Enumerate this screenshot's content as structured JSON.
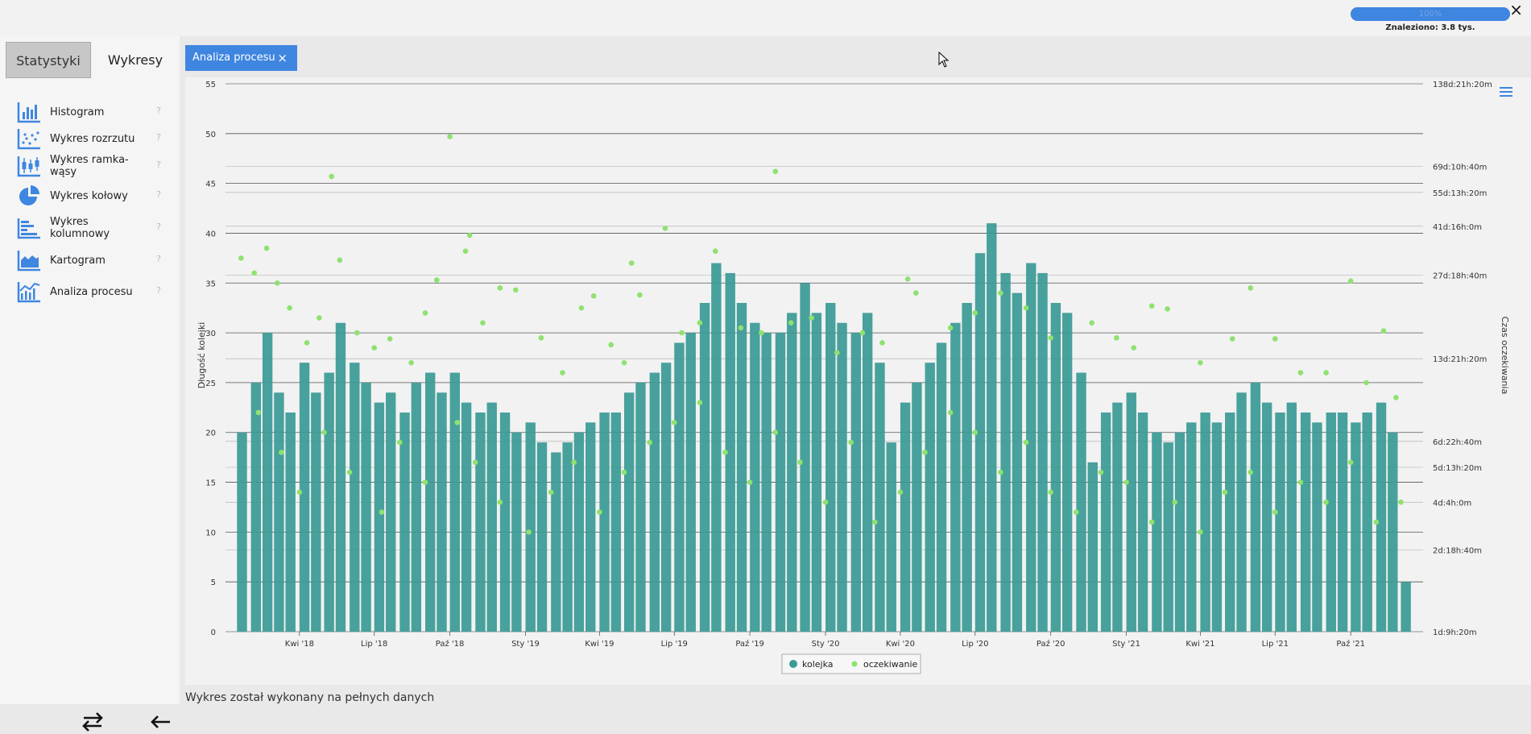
{
  "header": {
    "close_label": "×",
    "progress_text": "100%",
    "progress_value": 1.0,
    "found_text": "Znaleziono: 3.8 tys."
  },
  "sidebar": {
    "tabs": [
      {
        "label": "Statystyki",
        "active": false
      },
      {
        "label": "Wykresy",
        "active": true
      }
    ],
    "items": [
      {
        "label": "Histogram",
        "icon": "histogram-icon",
        "help": "?"
      },
      {
        "label": "Wykres rozrzutu",
        "icon": "scatter-icon",
        "help": "?"
      },
      {
        "label": "Wykres ramka-wąsy",
        "icon": "boxplot-icon",
        "help": "?"
      },
      {
        "label": "Wykres kołowy",
        "icon": "pie-icon",
        "help": "?"
      },
      {
        "label": "Wykres kolumnowy",
        "icon": "bar-horizontal-icon",
        "help": "?"
      },
      {
        "label": "Kartogram",
        "icon": "area-map-icon",
        "help": "?"
      },
      {
        "label": "Analiza procesu",
        "icon": "process-icon",
        "help": "?"
      }
    ],
    "bottom": {
      "swap_icon": "swap-arrows-icon",
      "back_icon": "arrow-left-icon"
    }
  },
  "main": {
    "tab": {
      "label": "Analiza procesu",
      "close": "×"
    },
    "footer_note": "Wykres został wykonany na pełnych danych",
    "menu_icon": "hamburger-menu-icon"
  },
  "colors": {
    "accent": "#3f86e0",
    "bar_color": "#3a9a95",
    "point_color": "#8ee26f"
  },
  "chart_data": {
    "type": "bar",
    "ylabel": "Długość kolejki",
    "y2label": "Czas oczekiwania",
    "ylim": [
      0,
      55
    ],
    "yticks": [
      0,
      5,
      10,
      15,
      20,
      25,
      30,
      35,
      40,
      45,
      50,
      55
    ],
    "y2ticks": [
      {
        "label": "1d:9h:20m",
        "value": 0
      },
      {
        "label": "2d:18h:40m",
        "value": 8.2
      },
      {
        "label": "4d:4h:0m",
        "value": 13.0
      },
      {
        "label": "5d:13h:20m",
        "value": 16.5
      },
      {
        "label": "6d:22h:40m",
        "value": 19.1
      },
      {
        "label": "13d:21h:20m",
        "value": 27.4
      },
      {
        "label": "27d:18h:40m",
        "value": 35.8
      },
      {
        "label": "41d:16h:0m",
        "value": 40.7
      },
      {
        "label": "55d:13h:20m",
        "value": 44.1
      },
      {
        "label": "69d:10h:40m",
        "value": 46.7
      },
      {
        "label": "138d:21h:20m",
        "value": 55
      }
    ],
    "x_range": [
      "2018-01",
      "2021-12"
    ],
    "xticks": [
      {
        "label": "Kwi '18",
        "date": "2018-04-01"
      },
      {
        "label": "Lip '18",
        "date": "2018-07-01"
      },
      {
        "label": "Paź '18",
        "date": "2018-10-01"
      },
      {
        "label": "Sty '19",
        "date": "2019-01-01"
      },
      {
        "label": "Kwi '19",
        "date": "2019-04-01"
      },
      {
        "label": "Lip '19",
        "date": "2019-07-01"
      },
      {
        "label": "Paź '19",
        "date": "2019-10-01"
      },
      {
        "label": "Sty '20",
        "date": "2020-01-01"
      },
      {
        "label": "Kwi '20",
        "date": "2020-04-01"
      },
      {
        "label": "Lip '20",
        "date": "2020-07-01"
      },
      {
        "label": "Paź '20",
        "date": "2020-10-01"
      },
      {
        "label": "Sty '21",
        "date": "2021-01-01"
      },
      {
        "label": "Kwi '21",
        "date": "2021-04-01"
      },
      {
        "label": "Lip '21",
        "date": "2021-07-01"
      },
      {
        "label": "Paź '21",
        "date": "2021-10-01"
      }
    ],
    "series": [
      {
        "name": "kolejka",
        "kind": "bar",
        "points": [
          [
            "2018-01-15",
            20
          ],
          [
            "2018-02-01",
            25
          ],
          [
            "2018-02-15",
            30
          ],
          [
            "2018-03-01",
            24
          ],
          [
            "2018-03-15",
            22
          ],
          [
            "2018-04-01",
            27
          ],
          [
            "2018-04-15",
            24
          ],
          [
            "2018-05-01",
            26
          ],
          [
            "2018-05-15",
            31
          ],
          [
            "2018-06-01",
            27
          ],
          [
            "2018-06-15",
            25
          ],
          [
            "2018-07-01",
            23
          ],
          [
            "2018-07-15",
            24
          ],
          [
            "2018-08-01",
            22
          ],
          [
            "2018-08-15",
            25
          ],
          [
            "2018-09-01",
            26
          ],
          [
            "2018-09-15",
            24
          ],
          [
            "2018-10-01",
            26
          ],
          [
            "2018-10-15",
            23
          ],
          [
            "2018-11-01",
            22
          ],
          [
            "2018-11-15",
            23
          ],
          [
            "2018-12-01",
            22
          ],
          [
            "2018-12-15",
            20
          ],
          [
            "2019-01-01",
            21
          ],
          [
            "2019-01-15",
            19
          ],
          [
            "2019-02-01",
            18
          ],
          [
            "2019-02-15",
            19
          ],
          [
            "2019-03-01",
            20
          ],
          [
            "2019-03-15",
            21
          ],
          [
            "2019-04-01",
            22
          ],
          [
            "2019-04-15",
            22
          ],
          [
            "2019-05-01",
            24
          ],
          [
            "2019-05-15",
            25
          ],
          [
            "2019-06-01",
            26
          ],
          [
            "2019-06-15",
            27
          ],
          [
            "2019-07-01",
            29
          ],
          [
            "2019-07-15",
            30
          ],
          [
            "2019-08-01",
            33
          ],
          [
            "2019-08-15",
            37
          ],
          [
            "2019-09-01",
            36
          ],
          [
            "2019-09-15",
            33
          ],
          [
            "2019-10-01",
            31
          ],
          [
            "2019-10-15",
            30
          ],
          [
            "2019-11-01",
            30
          ],
          [
            "2019-11-15",
            32
          ],
          [
            "2019-12-01",
            35
          ],
          [
            "2019-12-15",
            32
          ],
          [
            "2020-01-01",
            33
          ],
          [
            "2020-01-15",
            31
          ],
          [
            "2020-02-01",
            30
          ],
          [
            "2020-02-15",
            32
          ],
          [
            "2020-03-01",
            27
          ],
          [
            "2020-03-15",
            19
          ],
          [
            "2020-04-01",
            23
          ],
          [
            "2020-04-15",
            25
          ],
          [
            "2020-05-01",
            27
          ],
          [
            "2020-05-15",
            29
          ],
          [
            "2020-06-01",
            31
          ],
          [
            "2020-06-15",
            33
          ],
          [
            "2020-07-01",
            38
          ],
          [
            "2020-07-15",
            41
          ],
          [
            "2020-08-01",
            36
          ],
          [
            "2020-08-15",
            34
          ],
          [
            "2020-09-01",
            37
          ],
          [
            "2020-09-15",
            36
          ],
          [
            "2020-10-01",
            33
          ],
          [
            "2020-10-15",
            32
          ],
          [
            "2020-11-01",
            26
          ],
          [
            "2020-11-15",
            17
          ],
          [
            "2020-12-01",
            22
          ],
          [
            "2020-12-15",
            23
          ],
          [
            "2021-01-01",
            24
          ],
          [
            "2021-01-15",
            22
          ],
          [
            "2021-02-01",
            20
          ],
          [
            "2021-02-15",
            19
          ],
          [
            "2021-03-01",
            20
          ],
          [
            "2021-03-15",
            21
          ],
          [
            "2021-04-01",
            22
          ],
          [
            "2021-04-15",
            21
          ],
          [
            "2021-05-01",
            22
          ],
          [
            "2021-05-15",
            24
          ],
          [
            "2021-06-01",
            25
          ],
          [
            "2021-06-15",
            23
          ],
          [
            "2021-07-01",
            22
          ],
          [
            "2021-07-15",
            23
          ],
          [
            "2021-08-01",
            22
          ],
          [
            "2021-08-15",
            21
          ],
          [
            "2021-09-01",
            22
          ],
          [
            "2021-09-15",
            22
          ],
          [
            "2021-10-01",
            21
          ],
          [
            "2021-10-15",
            22
          ],
          [
            "2021-11-01",
            23
          ],
          [
            "2021-11-15",
            20
          ],
          [
            "2021-12-01",
            5
          ]
        ]
      },
      {
        "name": "oczekiwanie",
        "kind": "scatter",
        "points": [
          [
            "2018-01-20",
            37.5
          ],
          [
            "2018-02-05",
            36
          ],
          [
            "2018-02-20",
            38.5
          ],
          [
            "2018-03-05",
            35
          ],
          [
            "2018-03-20",
            32.5
          ],
          [
            "2018-04-10",
            29
          ],
          [
            "2018-04-25",
            31.5
          ],
          [
            "2018-05-10",
            45.7
          ],
          [
            "2018-05-20",
            37.3
          ],
          [
            "2018-06-10",
            30
          ],
          [
            "2018-07-01",
            28.5
          ],
          [
            "2018-07-20",
            29.4
          ],
          [
            "2018-08-15",
            27
          ],
          [
            "2018-09-01",
            32
          ],
          [
            "2018-09-15",
            35.3
          ],
          [
            "2018-10-01",
            49.7
          ],
          [
            "2018-10-20",
            38.2
          ],
          [
            "2018-10-25",
            39.8
          ],
          [
            "2018-11-10",
            31
          ],
          [
            "2018-12-01",
            34.5
          ],
          [
            "2018-12-20",
            34.3
          ],
          [
            "2019-01-20",
            29.5
          ],
          [
            "2019-02-15",
            26
          ],
          [
            "2019-03-10",
            32.5
          ],
          [
            "2019-03-25",
            33.7
          ],
          [
            "2019-04-15",
            28.8
          ],
          [
            "2019-05-01",
            27
          ],
          [
            "2019-05-10",
            37
          ],
          [
            "2019-05-20",
            33.8
          ],
          [
            "2019-06-20",
            40.5
          ],
          [
            "2019-07-10",
            30
          ],
          [
            "2019-08-01",
            31
          ],
          [
            "2019-08-20",
            38.2
          ],
          [
            "2019-09-20",
            30.5
          ],
          [
            "2019-10-15",
            30
          ],
          [
            "2019-11-01",
            46.2
          ],
          [
            "2019-11-20",
            31
          ],
          [
            "2019-12-15",
            31.5
          ],
          [
            "2020-01-15",
            28
          ],
          [
            "2020-02-15",
            30
          ],
          [
            "2020-03-10",
            29
          ],
          [
            "2020-04-10",
            35.4
          ],
          [
            "2020-04-20",
            34
          ],
          [
            "2020-06-01",
            30.5
          ],
          [
            "2020-07-01",
            32
          ],
          [
            "2020-08-01",
            34
          ],
          [
            "2020-09-01",
            32.5
          ],
          [
            "2020-10-01",
            29.5
          ],
          [
            "2020-11-20",
            31
          ],
          [
            "2020-12-20",
            29.5
          ],
          [
            "2021-01-10",
            28.5
          ],
          [
            "2021-02-01",
            32.7
          ],
          [
            "2021-02-20",
            32.4
          ],
          [
            "2021-04-01",
            27
          ],
          [
            "2021-05-10",
            29.4
          ],
          [
            "2021-06-01",
            34.5
          ],
          [
            "2021-07-01",
            29.4
          ],
          [
            "2021-08-01",
            26
          ],
          [
            "2021-09-01",
            26
          ],
          [
            "2021-10-01",
            35.2
          ],
          [
            "2021-10-20",
            25
          ],
          [
            "2021-11-10",
            30.2
          ],
          [
            "2021-11-25",
            23.5
          ],
          [
            "2018-02-10",
            22
          ],
          [
            "2018-03-10",
            18
          ],
          [
            "2018-04-01",
            14
          ],
          [
            "2018-05-01",
            20
          ],
          [
            "2018-06-01",
            16
          ],
          [
            "2018-07-10",
            12
          ],
          [
            "2018-08-01",
            19
          ],
          [
            "2018-09-01",
            15
          ],
          [
            "2018-10-10",
            21
          ],
          [
            "2018-11-01",
            17
          ],
          [
            "2018-12-01",
            13
          ],
          [
            "2019-01-05",
            10
          ],
          [
            "2019-02-01",
            14
          ],
          [
            "2019-03-01",
            17
          ],
          [
            "2019-04-01",
            12
          ],
          [
            "2019-05-01",
            16
          ],
          [
            "2019-06-01",
            19
          ],
          [
            "2019-07-01",
            21
          ],
          [
            "2019-08-01",
            23
          ],
          [
            "2019-09-01",
            18
          ],
          [
            "2019-10-01",
            15
          ],
          [
            "2019-11-01",
            20
          ],
          [
            "2019-12-01",
            17
          ],
          [
            "2020-01-01",
            13
          ],
          [
            "2020-02-01",
            19
          ],
          [
            "2020-03-01",
            11
          ],
          [
            "2020-04-01",
            14
          ],
          [
            "2020-05-01",
            18
          ],
          [
            "2020-06-01",
            22
          ],
          [
            "2020-07-01",
            20
          ],
          [
            "2020-08-01",
            16
          ],
          [
            "2020-09-01",
            19
          ],
          [
            "2020-10-01",
            14
          ],
          [
            "2020-11-01",
            12
          ],
          [
            "2020-12-01",
            16
          ],
          [
            "2021-01-01",
            15
          ],
          [
            "2021-02-01",
            11
          ],
          [
            "2021-03-01",
            13
          ],
          [
            "2021-04-01",
            10
          ],
          [
            "2021-05-01",
            14
          ],
          [
            "2021-06-01",
            16
          ],
          [
            "2021-07-01",
            12
          ],
          [
            "2021-08-01",
            15
          ],
          [
            "2021-09-01",
            13
          ],
          [
            "2021-10-01",
            17
          ],
          [
            "2021-11-01",
            11
          ],
          [
            "2021-12-01",
            13
          ]
        ]
      }
    ],
    "legend": [
      "kolejka",
      "oczekiwanie"
    ],
    "legend_position": "bottom-center",
    "grid": true
  }
}
